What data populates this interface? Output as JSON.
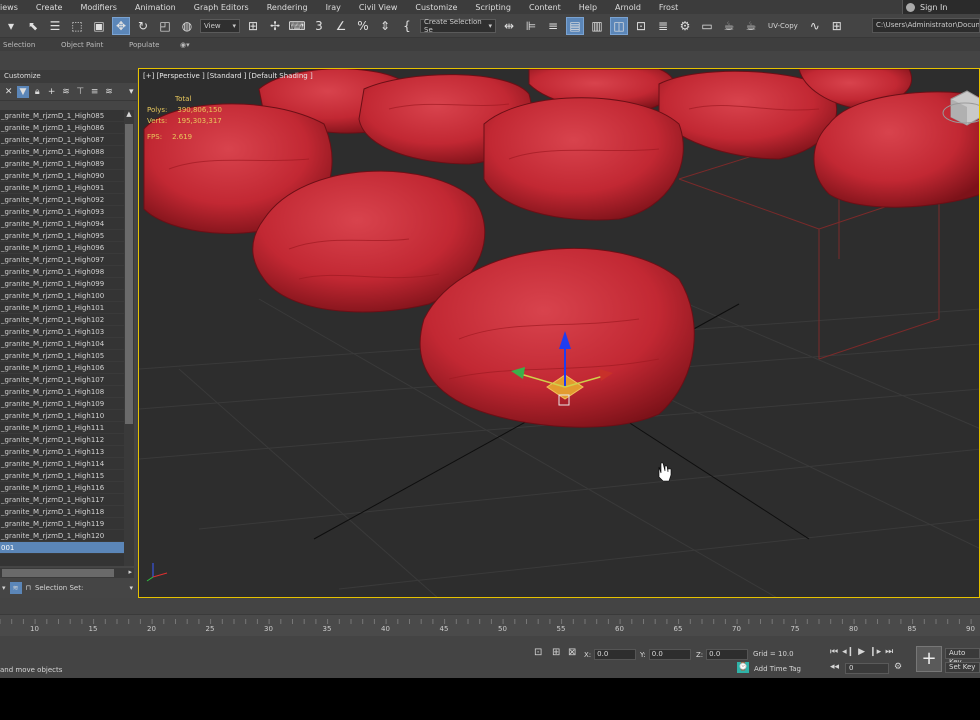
{
  "menu": [
    "iews",
    "Create",
    "Modifiers",
    "Animation",
    "Graph Editors",
    "Rendering",
    "Iray",
    "Civil View",
    "Customize",
    "Scripting",
    "Content",
    "Help",
    "Arnold",
    "Frost"
  ],
  "signin": "Sign In",
  "toolbar": {
    "view_dropdown": "View",
    "selection_set": "Create Selection Se",
    "uvcopy": "UV-Copy",
    "path": "C:\\Users\\Administrator\\Docum"
  },
  "ribbon": {
    "selection": "Selection",
    "object_paint": "Object Paint",
    "populate": "Populate"
  },
  "panel": {
    "header": "Customize",
    "items": [
      "_granite_M_rjzmD_1_High085",
      "_granite_M_rjzmD_1_High086",
      "_granite_M_rjzmD_1_High087",
      "_granite_M_rjzmD_1_High088",
      "_granite_M_rjzmD_1_High089",
      "_granite_M_rjzmD_1_High090",
      "_granite_M_rjzmD_1_High091",
      "_granite_M_rjzmD_1_High092",
      "_granite_M_rjzmD_1_High093",
      "_granite_M_rjzmD_1_High094",
      "_granite_M_rjzmD_1_High095",
      "_granite_M_rjzmD_1_High096",
      "_granite_M_rjzmD_1_High097",
      "_granite_M_rjzmD_1_High098",
      "_granite_M_rjzmD_1_High099",
      "_granite_M_rjzmD_1_High100",
      "_granite_M_rjzmD_1_High101",
      "_granite_M_rjzmD_1_High102",
      "_granite_M_rjzmD_1_High103",
      "_granite_M_rjzmD_1_High104",
      "_granite_M_rjzmD_1_High105",
      "_granite_M_rjzmD_1_High106",
      "_granite_M_rjzmD_1_High107",
      "_granite_M_rjzmD_1_High108",
      "_granite_M_rjzmD_1_High109",
      "_granite_M_rjzmD_1_High110",
      "_granite_M_rjzmD_1_High111",
      "_granite_M_rjzmD_1_High112",
      "_granite_M_rjzmD_1_High113",
      "_granite_M_rjzmD_1_High114",
      "_granite_M_rjzmD_1_High115",
      "_granite_M_rjzmD_1_High116",
      "_granite_M_rjzmD_1_High117",
      "_granite_M_rjzmD_1_High118",
      "_granite_M_rjzmD_1_High119",
      "_granite_M_rjzmD_1_High120",
      "001"
    ],
    "selection_set_label": "Selection Set:"
  },
  "viewport": {
    "label": "[+] [Perspective ] [Standard ] [Default Shading ]",
    "stats_total": "Total",
    "polys_label": "Polys:",
    "polys_value": "390,806,150",
    "verts_label": "Verts:",
    "verts_value": "195,303,317",
    "fps_label": "FPS:",
    "fps_value": "2.619",
    "rock_color": "#c62a35"
  },
  "timeline": {
    "ticks": [
      "10",
      "15",
      "20",
      "25",
      "30",
      "35",
      "40",
      "45",
      "50",
      "55",
      "60",
      "65",
      "70",
      "75",
      "80",
      "85",
      "90"
    ]
  },
  "status": {
    "prompt": "and move objects",
    "x_label": "X:",
    "x_value": "0.0",
    "y_label": "Y:",
    "y_value": "0.0",
    "z_label": "Z:",
    "z_value": "0.0",
    "grid": "Grid = 10.0",
    "add_time_tag": "Add Time Tag",
    "frame": "0",
    "auto_key": "Auto Key",
    "set_key": "Set Key"
  }
}
